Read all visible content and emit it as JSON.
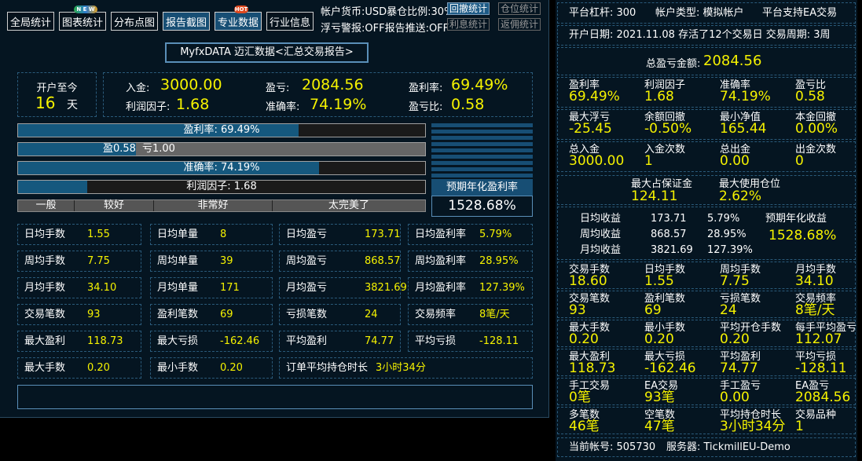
{
  "toolbar": {
    "buttons": [
      "全局统计",
      "图表统计",
      "分布点图",
      "报告截图",
      "专业数据",
      "行业信息"
    ],
    "badge_new": "N E W",
    "badge_hot": "HOT"
  },
  "top_info": {
    "line1": "帐户货币:USD暴仓比例:30%",
    "line2": "浮亏警报:OFF报告推送:OFF",
    "btn_drawdown": "回撤统计",
    "btn_position": "仓位统计",
    "btn_interest": "利息统计",
    "btn_rebate": "返佣统计"
  },
  "report_title": "MyfxDATA 迈汇数据<汇总交易报告>",
  "summary": {
    "since_open_label": "开户至今",
    "days": "16",
    "days_unit": "天",
    "deposit_label": "入金:",
    "deposit": "3000.00",
    "pnl_label": "盈亏:",
    "pnl": "2084.56",
    "profit_rate_label": "盈利率:",
    "profit_rate": "69.49%",
    "profit_factor_label": "利润因子:",
    "profit_factor": "1.68",
    "accuracy_label": "准确率:",
    "accuracy": "74.19%",
    "pl_ratio_label": "盈亏比:",
    "pl_ratio": "0.58"
  },
  "bars": {
    "profit_rate": {
      "text": "盈利率: 69.49%",
      "fill": 0.69
    },
    "pl_ratio": {
      "win_text": "盈0.58",
      "loss_text": "亏1.00",
      "fill": 0.29
    },
    "accuracy": {
      "text": "准确率: 74.19%",
      "fill": 0.74
    },
    "profit_factor": {
      "text": "利润因子: 1.68",
      "fill": 0.17
    },
    "levels": [
      "一般",
      "较好",
      "非常好",
      "太完美了"
    ]
  },
  "annual": {
    "label": "预期年化盈利率",
    "value": "1528.68%"
  },
  "stats_grid": [
    [
      [
        "日均手数",
        "1.55"
      ],
      [
        "日均单量",
        "8"
      ],
      [
        "日均盈亏",
        "173.71"
      ],
      [
        "日均盈利率",
        "5.79%"
      ]
    ],
    [
      [
        "周均手数",
        "7.75"
      ],
      [
        "周均单量",
        "39"
      ],
      [
        "周均盈亏",
        "868.57"
      ],
      [
        "周均盈利率",
        "28.95%"
      ]
    ],
    [
      [
        "月均手数",
        "34.10"
      ],
      [
        "月均单量",
        "171"
      ],
      [
        "月均盈亏",
        "3821.69"
      ],
      [
        "月均盈利率",
        "127.39%"
      ]
    ],
    [
      [
        "交易笔数",
        "93"
      ],
      [
        "盈利笔数",
        "69"
      ],
      [
        "亏损笔数",
        "24"
      ],
      [
        "交易频率",
        "8笔/天"
      ]
    ],
    [
      [
        "最大盈利",
        "118.73"
      ],
      [
        "最大亏损",
        "-162.46"
      ],
      [
        "平均盈利",
        "74.77"
      ],
      [
        "平均亏损",
        "-128.11"
      ]
    ]
  ],
  "last_row": {
    "k1": "最大手数",
    "v1": "0.20",
    "k2": "最小手数",
    "v2": "0.20",
    "k3": "订单平均持仓时长",
    "v3": "3小时34分"
  },
  "right": {
    "leverage": "平台杠杆: 300",
    "account_type": "帐户类型: 模拟帐户",
    "ea_support": "平台支持EA交易",
    "open_date": "开户日期: 2021.11.08 存活了12个交易日 交易周期: 3周",
    "total_pnl_label": "总盈亏金额:",
    "total_pnl": "2084.56",
    "grid1": [
      [
        [
          "盈利率",
          "69.49%"
        ],
        [
          "利润因子",
          "1.68"
        ],
        [
          "准确率",
          "74.19%"
        ],
        [
          "盈亏比",
          "0.58"
        ]
      ],
      [
        [
          "最大浮亏",
          "-25.45"
        ],
        [
          "余额回撤",
          "-0.50%"
        ],
        [
          "最小净值",
          "165.44"
        ],
        [
          "本金回撤",
          "0.00%"
        ]
      ],
      [
        [
          "总入金",
          "3000.00"
        ],
        [
          "入金次数",
          "1"
        ],
        [
          "总出金",
          "0.00"
        ],
        [
          "出金次数",
          "0"
        ]
      ]
    ],
    "margin": [
      [
        "最大占保证金",
        "124.11"
      ],
      [
        "最大使用仓位",
        "2.62%"
      ]
    ],
    "income": {
      "rows": [
        [
          "日均收益",
          "173.71",
          "5.79%"
        ],
        [
          "周均收益",
          "868.57",
          "28.95%"
        ],
        [
          "月均收益",
          "3821.69",
          "127.39%"
        ]
      ],
      "annual_label": "预期年化收益",
      "annual_value": "1528.68%"
    },
    "grid2": [
      [
        [
          "交易手数",
          "18.60"
        ],
        [
          "日均手数",
          "1.55"
        ],
        [
          "周均手数",
          "7.75"
        ],
        [
          "月均手数",
          "34.10"
        ]
      ],
      [
        [
          "交易笔数",
          "93"
        ],
        [
          "盈利笔数",
          "69"
        ],
        [
          "亏损笔数",
          "24"
        ],
        [
          "交易频率",
          "8笔/天"
        ]
      ],
      [
        [
          "最大手数",
          "0.20"
        ],
        [
          "最小手数",
          "0.20"
        ],
        [
          "平均开仓手数",
          "0.20"
        ],
        [
          "每手平均盈亏",
          "112.07"
        ]
      ],
      [
        [
          "最大盈利",
          "118.73"
        ],
        [
          "最大亏损",
          "-162.46"
        ],
        [
          "平均盈利",
          "74.77"
        ],
        [
          "平均亏损",
          "-128.11"
        ]
      ],
      [
        [
          "手工交易",
          "0笔"
        ],
        [
          "EA交易",
          "93笔"
        ],
        [
          "手工盈亏",
          "0.00"
        ],
        [
          "EA盈亏",
          "2084.56"
        ]
      ],
      [
        [
          "多笔数",
          "46笔"
        ],
        [
          "空笔数",
          "47笔"
        ],
        [
          "平均持仓时长",
          "3小时34分"
        ],
        [
          "交易品种",
          "1"
        ]
      ]
    ],
    "account": "当前帐号: 505730",
    "server": "服务器: TickmillEU-Demo"
  }
}
